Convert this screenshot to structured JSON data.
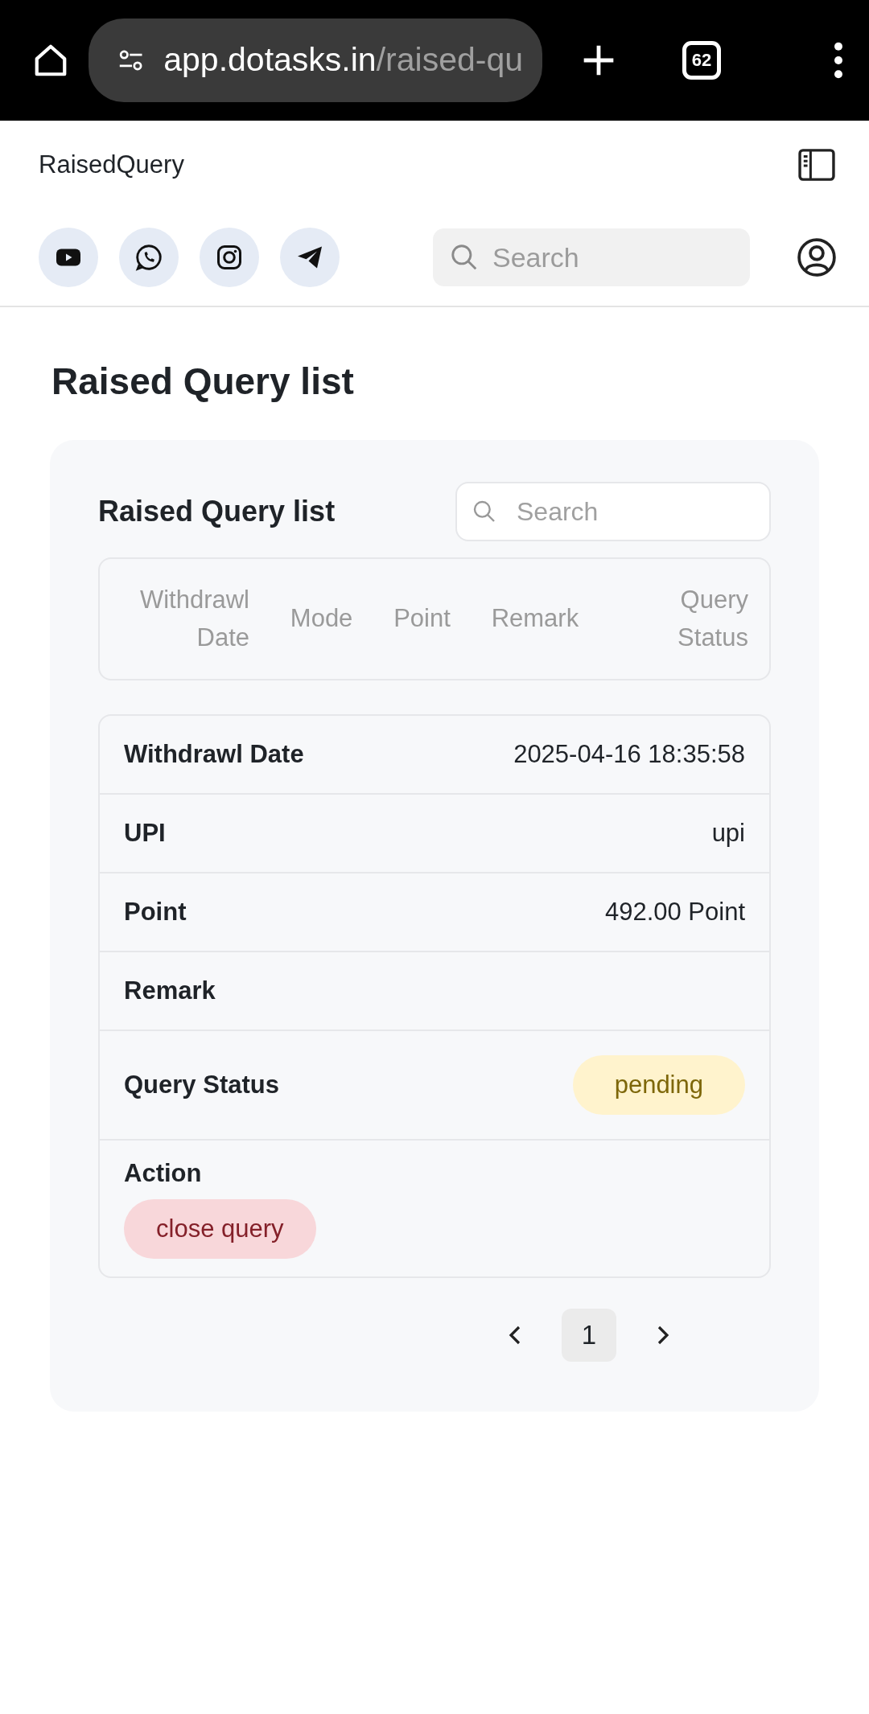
{
  "browser": {
    "url_host": "app.dotasks.in",
    "url_path": "/raised-qu",
    "tab_count": "62"
  },
  "app_bar": {
    "title": "RaisedQuery",
    "search": {
      "placeholder": "Search"
    }
  },
  "page_title": "Raised Query list",
  "card": {
    "title": "Raised Query list",
    "search": {
      "placeholder": "Search"
    },
    "columns": [
      "Withdrawl Date",
      "Mode",
      "Point",
      "Remark",
      "Query Status"
    ],
    "fields": [
      {
        "kind": "text",
        "label": "Withdrawl Date",
        "value": "2025-04-16 18:35:58"
      },
      {
        "kind": "text",
        "label": "UPI",
        "value": "upi"
      },
      {
        "kind": "text",
        "label": "Point",
        "value": "492.00 Point"
      },
      {
        "kind": "text",
        "label": "Remark"
      },
      {
        "kind": "badge",
        "label": "Query Status",
        "value": "pending"
      },
      {
        "kind": "button",
        "label": "Action",
        "value": "close query"
      }
    ]
  },
  "pagination": {
    "pages": [
      {
        "label": "1",
        "selected": true
      }
    ]
  }
}
